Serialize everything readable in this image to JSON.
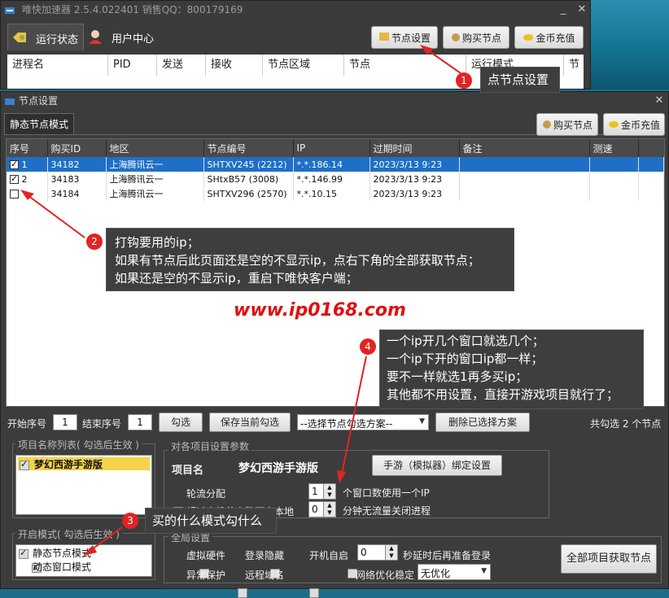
{
  "main_window": {
    "title": "唯快加速器 2.5.4.022401  销售QQ：800179169",
    "tabs": [
      {
        "label": "运行状态",
        "icon": "status-icon"
      },
      {
        "label": "用户中心",
        "icon": "user-icon"
      }
    ],
    "buttons": {
      "node_settings": "节点设置",
      "buy_nodes": "购买节点",
      "recharge": "金币充值"
    },
    "columns": [
      "进程名",
      "PID",
      "发送",
      "接收",
      "节点区域",
      "节点",
      "运行模式",
      "节"
    ]
  },
  "dialog": {
    "title": "节点设置",
    "tab": "静态节点模式",
    "buttons": {
      "buy_nodes": "购买节点",
      "recharge": "金币充值"
    },
    "columns": [
      "序号",
      "购买ID",
      "地区",
      "节点编号",
      "IP",
      "过期时间",
      "备注",
      "测速"
    ],
    "rows": [
      {
        "checked": true,
        "no": "1",
        "id": "34182",
        "region": "上海腾讯云一",
        "node": "SHTXV245 (2212)",
        "ip": "*.*.186.14",
        "expire": "2023/3/13 9:23",
        "note": "",
        "speed": ""
      },
      {
        "checked": true,
        "no": "2",
        "id": "34183",
        "region": "上海腾讯云一",
        "node": "SHtxB57 (3008)",
        "ip": "*.*.146.99",
        "expire": "2023/3/13 9:23",
        "note": "",
        "speed": ""
      },
      {
        "checked": false,
        "no": "",
        "id": "34184",
        "region": "上海腾讯云一",
        "node": "SHTXV296 (2570)",
        "ip": "*.*.10.15",
        "expire": "2023/3/13 9:23",
        "note": "",
        "speed": ""
      }
    ],
    "watermark": "www.ip0168.com",
    "bottom_bar": {
      "start_label": "开始序号",
      "start_value": "1",
      "end_label": "结束序号",
      "end_value": "1",
      "check_btn": "勾选",
      "save_btn": "保存当前勾选",
      "scheme_select": "--选择节点勾选方案--",
      "delete_btn": "删除已选择方案",
      "count_text": "共勾选 2 个节点"
    },
    "project_list": {
      "legend": "项目名称列表( 勾选后生效 )",
      "items": [
        {
          "label": "梦幻西游手游版",
          "checked": true
        }
      ]
    },
    "project_params": {
      "legend": "对各项目设置参数",
      "name_label": "项目名",
      "name_value": "梦幻西游手游版",
      "bind_btn": "手游（模拟器）绑定设置",
      "round_robin": "轮流分配",
      "exceed_local": "超过本机节点数可走本地",
      "windows_value": "1",
      "windows_label": "个窗口数使用一个IP",
      "minutes_value": "0",
      "minutes_label": "分钟无流量关闭进程"
    },
    "mode": {
      "legend": "开启模式( 勾选后生效 )",
      "items": [
        {
          "label": "静态节点模式",
          "checked": true
        },
        {
          "label": "动态窗口模式",
          "checked": true
        }
      ]
    },
    "global": {
      "legend": "全局设置",
      "virtual_hw": "虚拟硬件",
      "login_hide": "登录隐藏",
      "autostart": "开机自启",
      "delay_value": "0",
      "delay_label": "秒延时后再准备登录",
      "abnormal": "异常保护",
      "remote_domain": "远程域名",
      "net_label": "网络优化稳定",
      "net_value": "无优化"
    },
    "fetch_all_btn": "全部项目获取节点"
  },
  "callouts": [
    {
      "n": "1",
      "text": "点节点设置"
    },
    {
      "n": "2",
      "lines": [
        "打钩要用的ip；",
        "如果有节点后此页面还是空的不显示ip，点右下角的全部获取节点；",
        "如果还是空的不显示ip，重启下唯快客户端；"
      ]
    },
    {
      "n": "3",
      "text": "买的什么模式勾什么"
    },
    {
      "n": "4",
      "lines": [
        "一个ip开几个窗口就选几个；",
        "一个ip下开的窗口ip都一样；",
        "要不一样就选1再多买ip；",
        "其他都不用设置，直接开游戏项目就行了；"
      ]
    }
  ],
  "colors": {
    "accent": "#1e6fc8",
    "arrow": "#e02424",
    "watermark": "#e01010"
  }
}
